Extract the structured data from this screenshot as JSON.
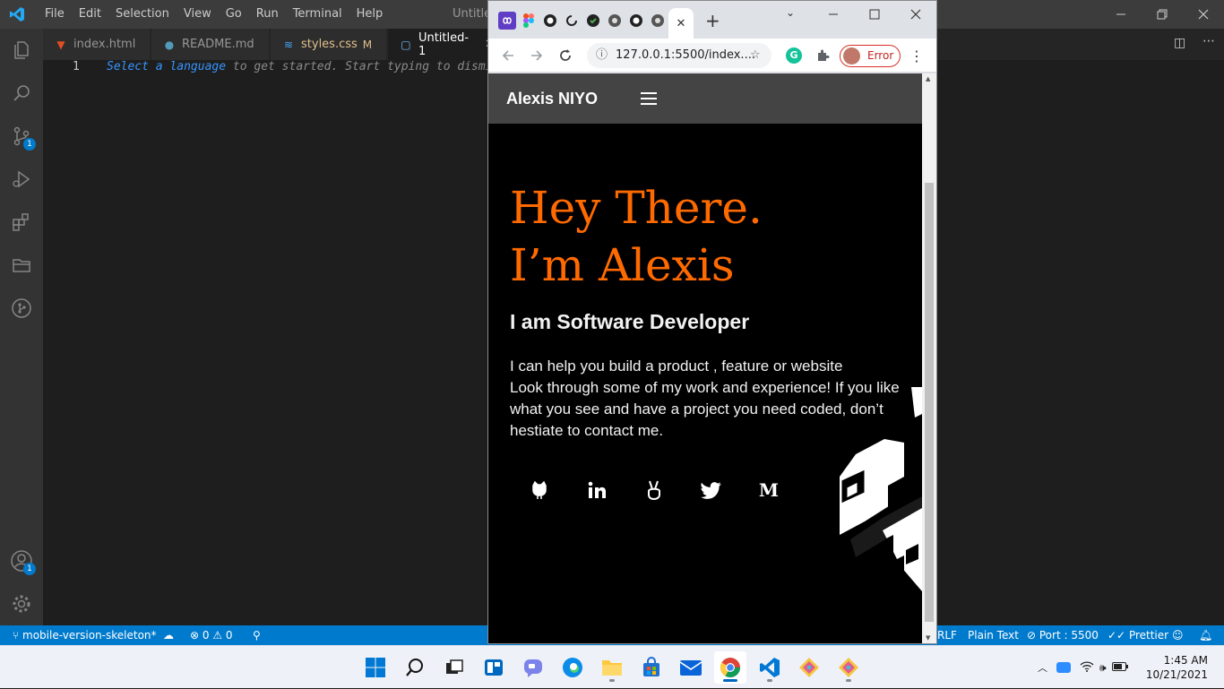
{
  "vscode": {
    "menu": [
      "File",
      "Edit",
      "Selection",
      "View",
      "Go",
      "Run",
      "Terminal",
      "Help"
    ],
    "window_title": "Untitled",
    "activity_badge_scm": "1",
    "activity_badge_account": "1",
    "tabs": [
      {
        "label": "index.html",
        "icon": "html5-icon",
        "color": "#e44d26"
      },
      {
        "label": "README.md",
        "icon": "info-icon",
        "color": "#519aba"
      },
      {
        "label": "styles.css",
        "icon": "css3-icon",
        "color": "#42a5f5",
        "modified": "M"
      },
      {
        "label": "Untitled-1",
        "icon": "file-icon",
        "color": "#75beff",
        "active": true
      }
    ],
    "line_number": "1",
    "hint_link": "Select a language",
    "hint_text": " to get started. Start typing to dismi",
    "status": {
      "branch": "mobile-version-skeleton*",
      "problems": "0",
      "warnings": "0",
      "eol": "RLF",
      "language": "Plain Text",
      "port": "Port : 5500",
      "prettier": "Prettier"
    }
  },
  "chrome": {
    "url": "127.0.0.1:5500/index....",
    "profile_status": "Error",
    "tab_close": "✕",
    "new_tab": "+"
  },
  "site": {
    "brand": "Alexis NIYO",
    "hero_line1": "Hey There.",
    "hero_line2": "I’m Alexis",
    "role": "I am Software Developer",
    "about_line1": "I can help you build a product , feature or website",
    "about_line2": "Look through some of my work and experience! If you like what you see and have a project you need coded, don’t hestiate to contact me.",
    "socials": [
      "github-icon",
      "linkedin-icon",
      "angellist-icon",
      "twitter-icon",
      "medium-icon"
    ],
    "medium_letter": "M",
    "accent_color": "#ff6a00"
  },
  "taskbar": {
    "time": "1:45 AM",
    "date": "10/21/2021"
  }
}
